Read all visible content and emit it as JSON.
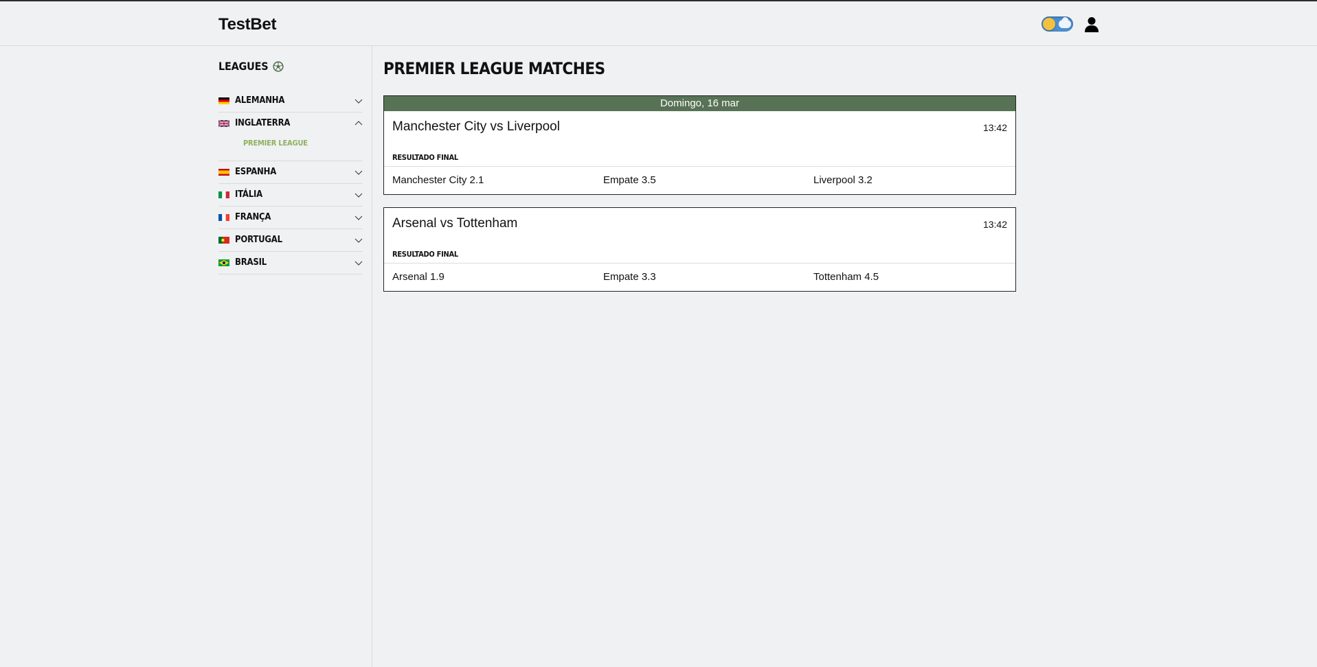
{
  "header": {
    "brand": "TestBet"
  },
  "sidebar": {
    "title": "LEAGUES",
    "countries": [
      {
        "label": "ALEMANHA",
        "expanded": false
      },
      {
        "label": "INGLATERRA",
        "expanded": true,
        "leagues": [
          "PREMIER LEAGUE"
        ]
      },
      {
        "label": "ESPANHA",
        "expanded": false
      },
      {
        "label": "ITÁLIA",
        "expanded": false
      },
      {
        "label": "FRANÇA",
        "expanded": false
      },
      {
        "label": "PORTUGAL",
        "expanded": false
      },
      {
        "label": "BRASIL",
        "expanded": false
      }
    ]
  },
  "main": {
    "title": "PREMIER LEAGUE MATCHES",
    "date_label": "Domingo, 16 mar",
    "matches": [
      {
        "name": "Manchester City vs Liverpool",
        "time": "13:42",
        "market": "RESULTADO FINAL",
        "odds": [
          "Manchester City 2.1",
          "Empate 3.5",
          "Liverpool 3.2"
        ]
      },
      {
        "name": "Arsenal vs Tottenham",
        "time": "13:42",
        "market": "RESULTADO FINAL",
        "odds": [
          "Arsenal 1.9",
          "Empate 3.3",
          "Tottenham 4.5"
        ]
      }
    ]
  },
  "colors": {
    "accent": "#577254",
    "sub_league": "#8fb05e",
    "background": "#f0f1f3"
  }
}
